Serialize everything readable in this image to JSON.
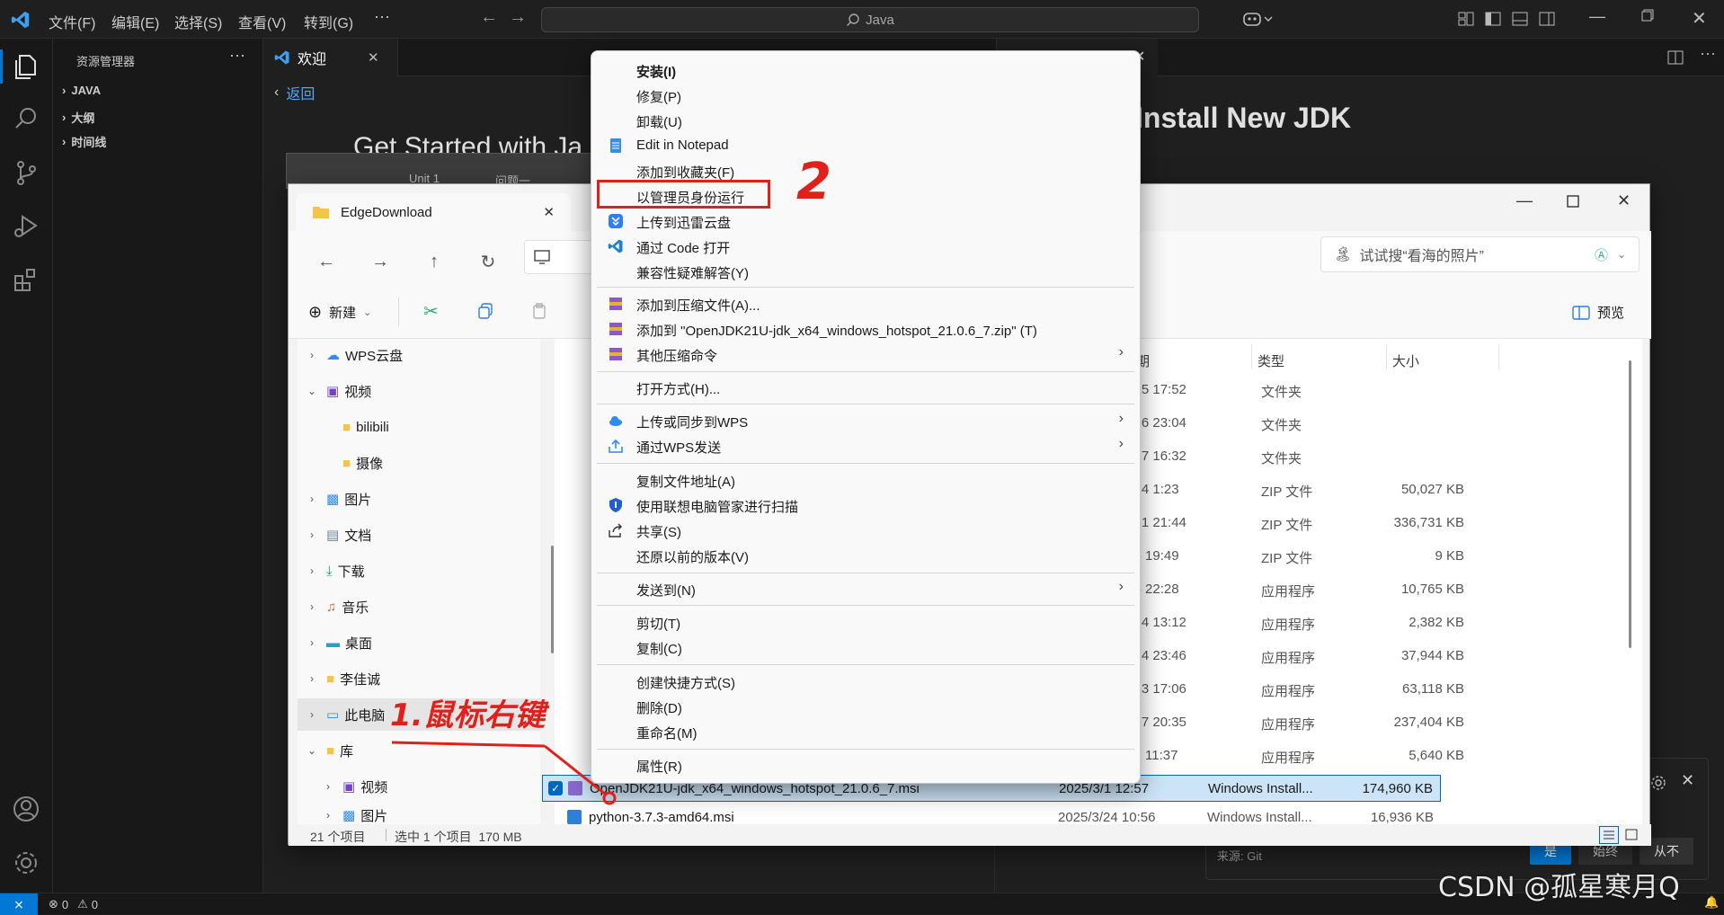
{
  "vscode": {
    "menus": [
      "文件(F)",
      "编辑(E)",
      "选择(S)",
      "查看(V)",
      "转到(G)",
      "···"
    ],
    "search": "Java",
    "sidebar_title": "资源管理器",
    "sidebar_sections": [
      "JAVA",
      "大纲",
      "时间线"
    ],
    "tab_welcome": "欢迎",
    "back_link": "返回",
    "heading_left": "Get Started with Ja",
    "heading_right": "Install New JDK",
    "status_errors": "0",
    "status_warnings": "0",
    "notif_source": "来源: Git",
    "notif_btn1": "是",
    "notif_btn2": "始终",
    "notif_btn3": "从不"
  },
  "explorer": {
    "tab_title": "EdgeDownload",
    "search_placeholder": "试试搜“看海的照片”",
    "new_label": "新建",
    "preview_label": "预览",
    "back_tab_items": [
      "Unit 1",
      "问题一"
    ],
    "tree": [
      {
        "label": "WPS云盘",
        "chevron": "›"
      },
      {
        "label": "视频",
        "chevron": "⌄"
      },
      {
        "label": "bilibili",
        "chevron": ""
      },
      {
        "label": "摄像",
        "chevron": ""
      },
      {
        "label": "图片",
        "chevron": "›"
      },
      {
        "label": "文档",
        "chevron": "›"
      },
      {
        "label": "下载",
        "chevron": "›"
      },
      {
        "label": "音乐",
        "chevron": "›"
      },
      {
        "label": "桌面",
        "chevron": "›"
      },
      {
        "label": "李佳诚",
        "chevron": "›"
      },
      {
        "label": "此电脑",
        "chevron": "›"
      },
      {
        "label": "库",
        "chevron": "⌄"
      },
      {
        "label": "视频",
        "chevron": "›"
      },
      {
        "label": "图片",
        "chevron": "›"
      }
    ],
    "columns": {
      "date": "日期",
      "type": "类型",
      "size": "大小"
    },
    "rows": [
      {
        "date": "2/15 17:52",
        "type": "文件夹",
        "size": ""
      },
      {
        "date": "2/26 23:04",
        "type": "文件夹",
        "size": ""
      },
      {
        "date": "2/17 16:32",
        "type": "文件夹",
        "size": ""
      },
      {
        "date": "1/24 1:23",
        "type": "ZIP 文件",
        "size": "50,027 KB"
      },
      {
        "date": "1/31 21:44",
        "type": "ZIP 文件",
        "size": "336,731 KB"
      },
      {
        "date": "2/6 19:49",
        "type": "ZIP 文件",
        "size": "9 KB"
      },
      {
        "date": "2/5 22:28",
        "type": "应用程序",
        "size": "10,765 KB"
      },
      {
        "date": "1/24 13:12",
        "type": "应用程序",
        "size": "2,382 KB"
      },
      {
        "date": "1/24 23:46",
        "type": "应用程序",
        "size": "37,944 KB"
      },
      {
        "date": "2/13 17:06",
        "type": "应用程序",
        "size": "63,118 KB"
      },
      {
        "date": "1/27 20:35",
        "type": "应用程序",
        "size": "237,404 KB"
      },
      {
        "date": "2/2 11:37",
        "type": "应用程序",
        "size": "5,640 KB"
      }
    ],
    "selected_row": {
      "name": "OpenJDK21U-jdk_x64_windows_hotspot_21.0.6_7.msi",
      "date": "2025/3/1 12:57",
      "type": "Windows Install...",
      "size": "174,960 KB"
    },
    "partial_row": {
      "name": "python-3.7.3-amd64.msi",
      "date": "2025/3/24 10:56",
      "type": "Windows Install...",
      "size": "16,936 KB"
    },
    "status_count": "21 个项目",
    "status_selected": "选中 1 个项目  170 MB"
  },
  "context_menu": [
    {
      "label": "安装(I)",
      "bold": true,
      "icon": "",
      "arrow": false
    },
    {
      "label": "修复(P)",
      "icon": "",
      "arrow": false
    },
    {
      "label": "卸载(U)",
      "icon": "",
      "arrow": false
    },
    {
      "label": "Edit in Notepad",
      "icon": "notepad-icon",
      "arrow": false
    },
    {
      "label": "添加到收藏夹(F)",
      "icon": "",
      "arrow": false
    },
    {
      "label": "以管理员身份运行",
      "icon": "",
      "arrow": false
    },
    {
      "label": "上传到迅雷云盘",
      "icon": "thunder-icon",
      "arrow": false
    },
    {
      "label": "通过 Code 打开",
      "icon": "vscode-icon",
      "arrow": false
    },
    {
      "label": "兼容性疑难解答(Y)",
      "icon": "",
      "arrow": false
    },
    {
      "label": "添加到压缩文件(A)...",
      "icon": "winrar-icon",
      "arrow": false
    },
    {
      "label": "添加到 \"OpenJDK21U-jdk_x64_windows_hotspot_21.0.6_7.zip\" (T)",
      "icon": "winrar-icon",
      "arrow": false
    },
    {
      "label": "其他压缩命令",
      "icon": "winrar-icon",
      "arrow": true
    },
    {
      "label": "打开方式(H)...",
      "icon": "",
      "arrow": false
    },
    {
      "label": "上传或同步到WPS",
      "icon": "wps-cloud-icon",
      "arrow": true
    },
    {
      "label": "通过WPS发送",
      "icon": "wps-send-icon",
      "arrow": true
    },
    {
      "label": "复制文件地址(A)",
      "icon": "",
      "arrow": false
    },
    {
      "label": "使用联想电脑管家进行扫描",
      "icon": "lenovo-shield-icon",
      "arrow": false
    },
    {
      "label": "共享(S)",
      "icon": "share-icon",
      "arrow": false
    },
    {
      "label": "还原以前的版本(V)",
      "icon": "",
      "arrow": false
    },
    {
      "label": "发送到(N)",
      "icon": "",
      "arrow": true
    },
    {
      "label": "剪切(T)",
      "icon": "",
      "arrow": false
    },
    {
      "label": "复制(C)",
      "icon": "",
      "arrow": false
    },
    {
      "label": "创建快捷方式(S)",
      "icon": "",
      "arrow": false
    },
    {
      "label": "删除(D)",
      "icon": "",
      "arrow": false
    },
    {
      "label": "重命名(M)",
      "icon": "",
      "arrow": false
    },
    {
      "label": "属性(R)",
      "icon": "",
      "arrow": false
    }
  ],
  "annotations": {
    "step1": "1.鼠标右键",
    "step2": "2",
    "watermark": "CSDN @孤星寒月Q"
  },
  "colors": {
    "annotation_red": "#e0201b",
    "vscode_blue": "#2f80ed",
    "selection": "#cce4f7"
  }
}
